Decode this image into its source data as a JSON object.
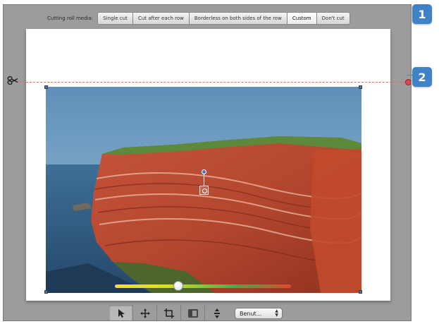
{
  "cut_bar": {
    "label": "Cutting roll media:",
    "options": [
      {
        "label": "Single cut"
      },
      {
        "label": "Cut after each row"
      },
      {
        "label": "Borderless on both sides of the row"
      },
      {
        "label": "Custom",
        "selected": true
      },
      {
        "label": "Don't cut"
      }
    ]
  },
  "toolbar": {
    "tools": [
      "select-arrow-icon",
      "move-cross-icon",
      "crop-icon",
      "frame-icon",
      "pan-zoom-icon"
    ],
    "dropdown_value": "Benut..."
  },
  "callouts": [
    "1",
    "2"
  ],
  "quality_slider": {
    "value_fraction": 0.36
  },
  "colors": {
    "callout": "#3f82c6",
    "cut_line": "#e06b6b",
    "frame_background": "#9c9c9c"
  }
}
